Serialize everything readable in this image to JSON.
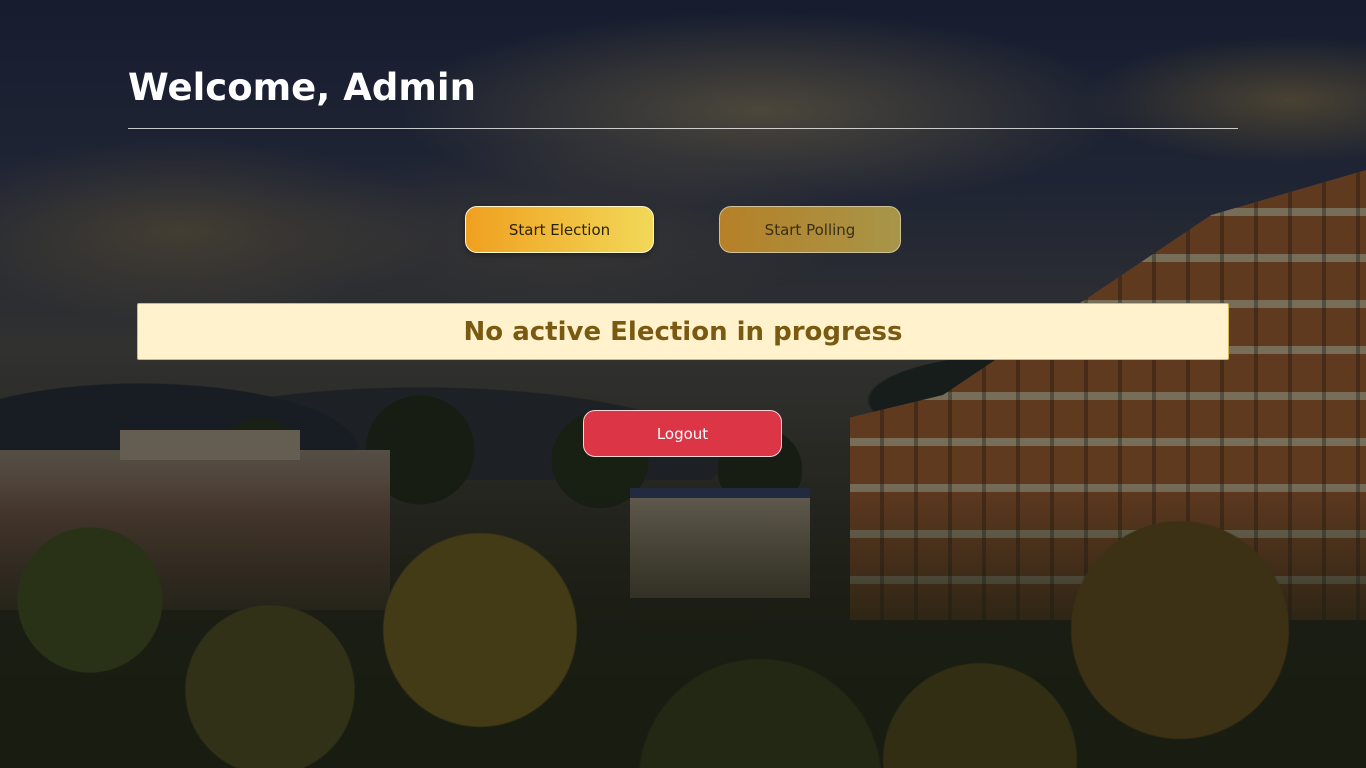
{
  "header": {
    "title": "Welcome, Admin"
  },
  "actions": {
    "start_election_label": "Start Election",
    "start_polling_label": "Start Polling"
  },
  "status": {
    "message": "No active Election in progress"
  },
  "logout": {
    "label": "Logout"
  },
  "colors": {
    "status_background": "#fff2cc",
    "status_text": "#7a5a10",
    "logout_button": "#dc3545",
    "start_election_gradient_start": "#f0a020",
    "start_election_gradient_end": "#f2d858"
  }
}
